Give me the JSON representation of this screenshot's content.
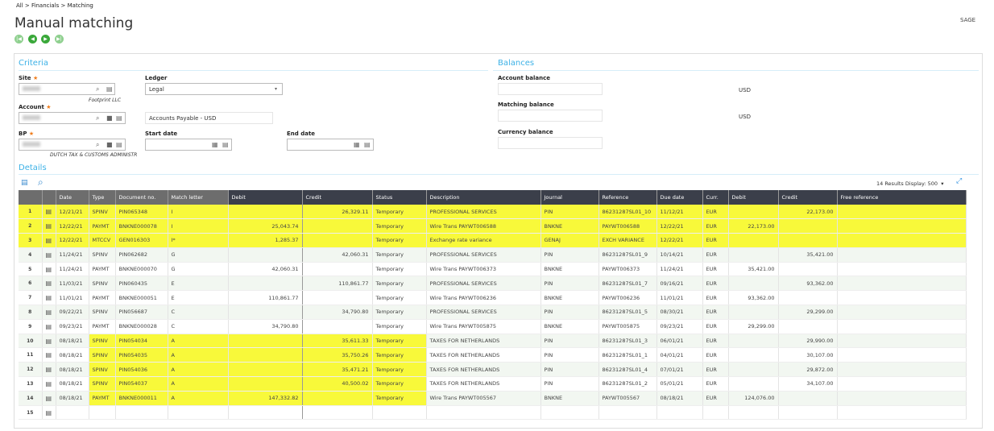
{
  "breadcrumb": [
    "All >",
    "Financials >",
    "Matching"
  ],
  "page_title": "Manual matching",
  "user": "SAGE",
  "criteria": {
    "title": "Criteria",
    "site_label": "Site",
    "site_desc": "Footprint LLC",
    "ledger_label": "Ledger",
    "ledger_value": "Legal",
    "account_label": "Account",
    "account_desc": "Accounts Payable - USD",
    "bp_label": "BP",
    "bp_desc": "DUTCH TAX & CUSTOMS ADMINISTR",
    "start_date_label": "Start date",
    "end_date_label": "End date"
  },
  "balances": {
    "title": "Balances",
    "account_balance_label": "Account balance",
    "account_currency": "USD",
    "matching_balance_label": "Matching balance",
    "matching_currency": "USD",
    "currency_balance_label": "Currency balance"
  },
  "details": {
    "title": "Details",
    "results": "14 Results",
    "display_label": "Display:",
    "display_value": "500",
    "columns": [
      "",
      "",
      "Date",
      "Type",
      "Document no.",
      "Match letter",
      "Debit",
      "Credit",
      "Status",
      "Description",
      "Journal",
      "Reference",
      "Due date",
      "Curr.",
      "Debit",
      "Credit",
      "Free reference"
    ],
    "rows": [
      [
        "1",
        "12/21/21",
        "SPINV",
        "PIN065348",
        "I",
        "",
        "26,329.11",
        "Temporary",
        "PROFESSIONAL SERVICES",
        "PIN",
        "86231287SL01_10",
        "11/12/21",
        "EUR",
        "",
        "22,173.00",
        ""
      ],
      [
        "2",
        "12/22/21",
        "PAYMT",
        "BNKNE000078",
        "I",
        "25,043.74",
        "",
        "Temporary",
        "Wire Trans PAYWT006588",
        "BNKNE",
        "PAYWT006588",
        "12/22/21",
        "EUR",
        "22,173.00",
        "",
        ""
      ],
      [
        "3",
        "12/22/21",
        "MTCCV",
        "GEN016303",
        "I*",
        "1,285.37",
        "",
        "Temporary",
        "Exchange rate variance",
        "GENAJ",
        "EXCH VARIANCE",
        "12/22/21",
        "EUR",
        "",
        "",
        ""
      ],
      [
        "4",
        "11/24/21",
        "SPINV",
        "PIN062682",
        "G",
        "",
        "42,060.31",
        "Temporary",
        "PROFESSIONAL SERVICES",
        "PIN",
        "86231287SL01_9",
        "10/14/21",
        "EUR",
        "",
        "35,421.00",
        ""
      ],
      [
        "5",
        "11/24/21",
        "PAYMT",
        "BNKNE000070",
        "G",
        "42,060.31",
        "",
        "Temporary",
        "Wire Trans PAYWT006373",
        "BNKNE",
        "PAYWT006373",
        "11/24/21",
        "EUR",
        "35,421.00",
        "",
        ""
      ],
      [
        "6",
        "11/03/21",
        "SPINV",
        "PIN060435",
        "E",
        "",
        "110,861.77",
        "Temporary",
        "PROFESSIONAL SERVICES",
        "PIN",
        "86231287SL01_7",
        "09/16/21",
        "EUR",
        "",
        "93,362.00",
        ""
      ],
      [
        "7",
        "11/01/21",
        "PAYMT",
        "BNKNE000051",
        "E",
        "110,861.77",
        "",
        "Temporary",
        "Wire Trans PAYWT006236",
        "BNKNE",
        "PAYWT006236",
        "11/01/21",
        "EUR",
        "93,362.00",
        "",
        ""
      ],
      [
        "8",
        "09/22/21",
        "SPINV",
        "PIN056687",
        "C",
        "",
        "34,790.80",
        "Temporary",
        "PROFESSIONAL SERVICES",
        "PIN",
        "86231287SL01_5",
        "08/30/21",
        "EUR",
        "",
        "29,299.00",
        ""
      ],
      [
        "9",
        "09/23/21",
        "PAYMT",
        "BNKNE000028",
        "C",
        "34,790.80",
        "",
        "Temporary",
        "Wire Trans PAYWT005875",
        "BNKNE",
        "PAYWT005875",
        "09/23/21",
        "EUR",
        "29,299.00",
        "",
        ""
      ],
      [
        "10",
        "08/18/21",
        "SPINV",
        "PIN054034",
        "A",
        "",
        "35,611.33",
        "Temporary",
        "TAXES FOR NETHERLANDS",
        "PIN",
        "86231287SL01_3",
        "06/01/21",
        "EUR",
        "",
        "29,990.00",
        ""
      ],
      [
        "11",
        "08/18/21",
        "SPINV",
        "PIN054035",
        "A",
        "",
        "35,750.26",
        "Temporary",
        "TAXES FOR NETHERLANDS",
        "PIN",
        "86231287SL01_1",
        "04/01/21",
        "EUR",
        "",
        "30,107.00",
        ""
      ],
      [
        "12",
        "08/18/21",
        "SPINV",
        "PIN054036",
        "A",
        "",
        "35,471.21",
        "Temporary",
        "TAXES FOR NETHERLANDS",
        "PIN",
        "86231287SL01_4",
        "07/01/21",
        "EUR",
        "",
        "29,872.00",
        ""
      ],
      [
        "13",
        "08/18/21",
        "SPINV",
        "PIN054037",
        "A",
        "",
        "40,500.02",
        "Temporary",
        "TAXES FOR NETHERLANDS",
        "PIN",
        "86231287SL01_2",
        "05/01/21",
        "EUR",
        "",
        "34,107.00",
        ""
      ],
      [
        "14",
        "08/18/21",
        "PAYMT",
        "BNKNE000011",
        "A",
        "147,332.82",
        "",
        "Temporary",
        "Wire Trans PAYWT005567",
        "BNKNE",
        "PAYWT005567",
        "08/18/21",
        "EUR",
        "124,076.00",
        "",
        ""
      ],
      [
        "15",
        "",
        "",
        "",
        "",
        "",
        "",
        "",
        "",
        "",
        "",
        "",
        "",
        "",
        "",
        ""
      ]
    ],
    "highlight_full_rows": [
      1,
      2,
      3
    ],
    "highlight_partial_rows": [
      10,
      11,
      12,
      13,
      14
    ],
    "highlight_color": "#f8f93a"
  }
}
